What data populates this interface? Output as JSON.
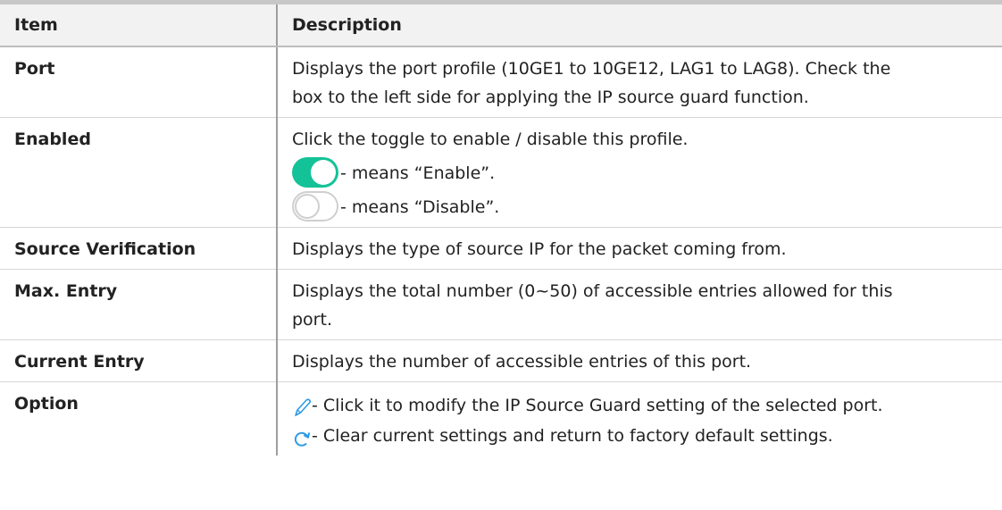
{
  "table": {
    "headers": {
      "item": "Item",
      "description": "Description"
    },
    "rows": [
      {
        "item": "Port",
        "lines": [
          "Displays the port profile (10GE1 to 10GE12, LAG1 to LAG8). Check the",
          "box to the left side for applying the IP source guard function."
        ]
      },
      {
        "item": "Enabled",
        "lines": [
          "Click the toggle to enable / disable this profile."
        ],
        "toggle_on_text": "- means “Enable”.",
        "toggle_off_text": "- means “Disable”."
      },
      {
        "item": "Source Verification",
        "lines": [
          "Displays the type of source IP for the packet coming from."
        ]
      },
      {
        "item": "Max. Entry",
        "lines": [
          "Displays the total number (0~50) of accessible entries allowed for this",
          "port."
        ]
      },
      {
        "item": "Current Entry",
        "lines": [
          "Displays the number of accessible entries of this port."
        ]
      },
      {
        "item": "Option",
        "edit_text": "- Click it to modify the IP Source Guard setting of the selected port.",
        "reset_text": "- Clear current settings and return to factory default settings."
      }
    ]
  },
  "colors": {
    "toggle_on": "#14c297",
    "toggle_off_border": "#cfcfcf",
    "icon_blue": "#2f9be6"
  },
  "icons": {
    "edit": "pencil-icon",
    "reset": "refresh-icon"
  }
}
